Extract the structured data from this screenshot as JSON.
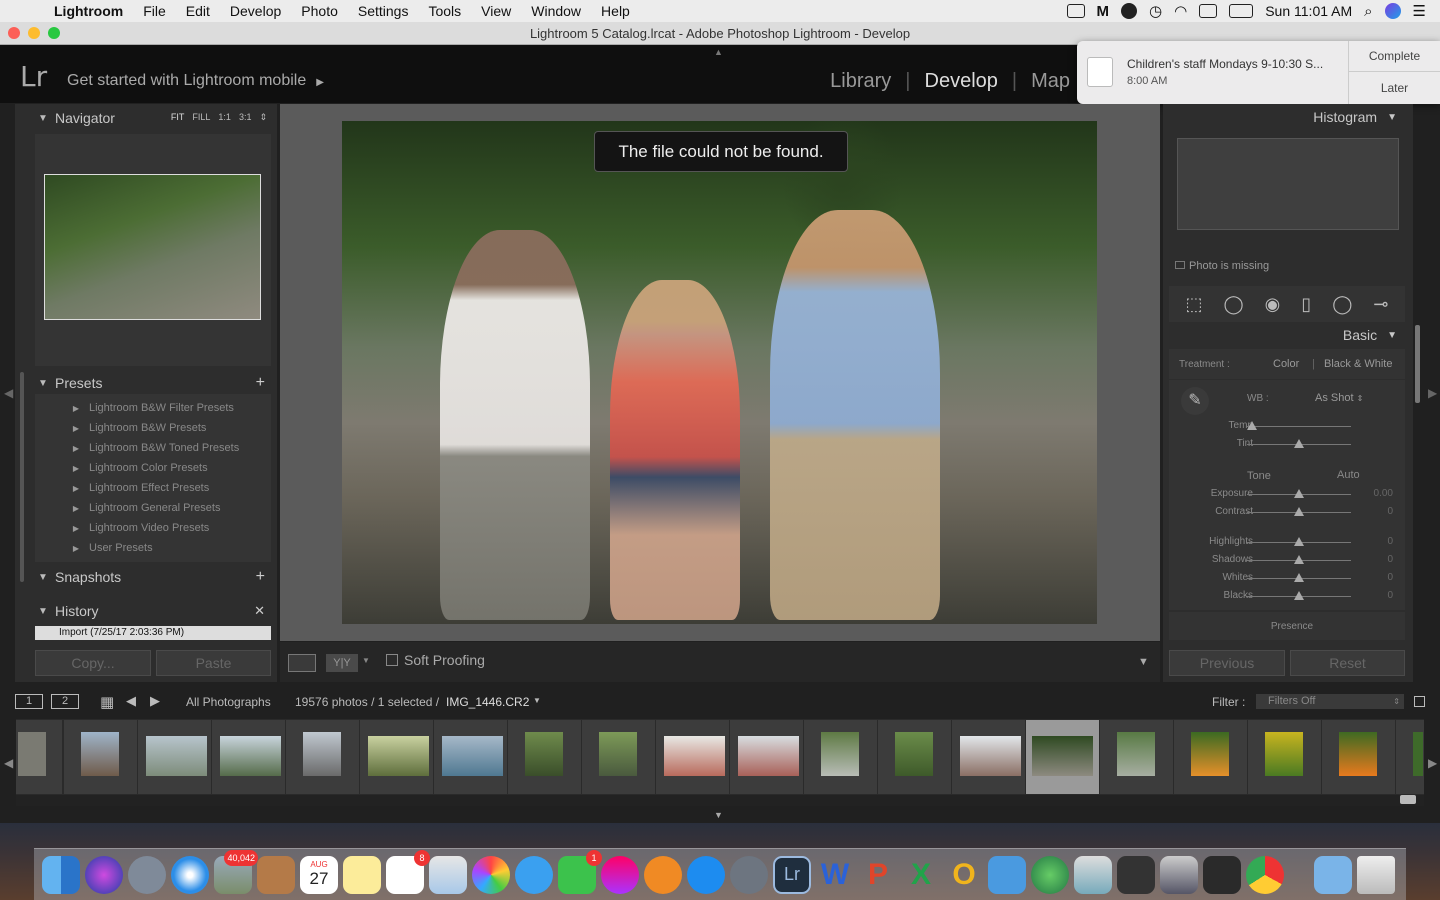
{
  "menubar": {
    "app_name": "Lightroom",
    "items": [
      "File",
      "Edit",
      "Develop",
      "Photo",
      "Settings",
      "Tools",
      "View",
      "Window",
      "Help"
    ],
    "clock": "Sun 11:01 AM"
  },
  "window": {
    "title": "Lightroom 5 Catalog.lrcat - Adobe Photoshop Lightroom - Develop"
  },
  "identity": {
    "logo": "Lr",
    "mobile_prompt": "Get started with Lightroom mobile"
  },
  "modules": {
    "library": "Library",
    "develop": "Develop",
    "map": "Map"
  },
  "notification": {
    "title": "Children's staff Mondays 9-10:30 S...",
    "time": "8:00 AM",
    "complete": "Complete",
    "later": "Later"
  },
  "left": {
    "navigator": "Navigator",
    "nav_fit": "FIT",
    "nav_fill": "FILL",
    "nav_1to1": "1:1",
    "nav_3to1": "3:1",
    "presets": "Presets",
    "preset_items": [
      "Lightroom B&W Filter Presets",
      "Lightroom B&W Presets",
      "Lightroom B&W Toned Presets",
      "Lightroom Color Presets",
      "Lightroom Effect Presets",
      "Lightroom General Presets",
      "Lightroom Video Presets",
      "User Presets"
    ],
    "snapshots": "Snapshots",
    "history": "History",
    "history_item": "Import (7/25/17 2:03:36 PM)",
    "copy": "Copy...",
    "paste": "Paste"
  },
  "center": {
    "toast": "The file could not be found.",
    "yy_label": "Y|Y",
    "soft_proofing": "Soft Proofing"
  },
  "right": {
    "histogram": "Histogram",
    "photo_missing": "Photo is missing",
    "basic": "Basic",
    "treatment_label": "Treatment :",
    "treatment_color": "Color",
    "treatment_bw": "Black & White",
    "wb_label": "WB :",
    "wb_value": "As Shot",
    "temp": "Temp",
    "tint": "Tint",
    "tone": "Tone",
    "auto": "Auto",
    "exposure": "Exposure",
    "exposure_value": "0.00",
    "contrast": "Contrast",
    "contrast_value": "0",
    "highlights": "Highlights",
    "highlights_value": "0",
    "shadows": "Shadows",
    "shadows_value": "0",
    "whites": "Whites",
    "whites_value": "0",
    "blacks": "Blacks",
    "blacks_value": "0",
    "presence": "Presence",
    "previous": "Previous",
    "reset": "Reset"
  },
  "filmstrip": {
    "monitor1": "1",
    "monitor2": "2",
    "source": "All Photographs",
    "count_info": "19576 photos / 1 selected /",
    "filename": "IMG_1446.CR2",
    "filter_label": "Filter :",
    "filter_value": "Filters Off"
  },
  "dock": {
    "photos_badge": "40,042",
    "calendar_month": "AUG",
    "calendar_day": "27",
    "reminders_badge": "8",
    "facetime_badge": "1"
  }
}
